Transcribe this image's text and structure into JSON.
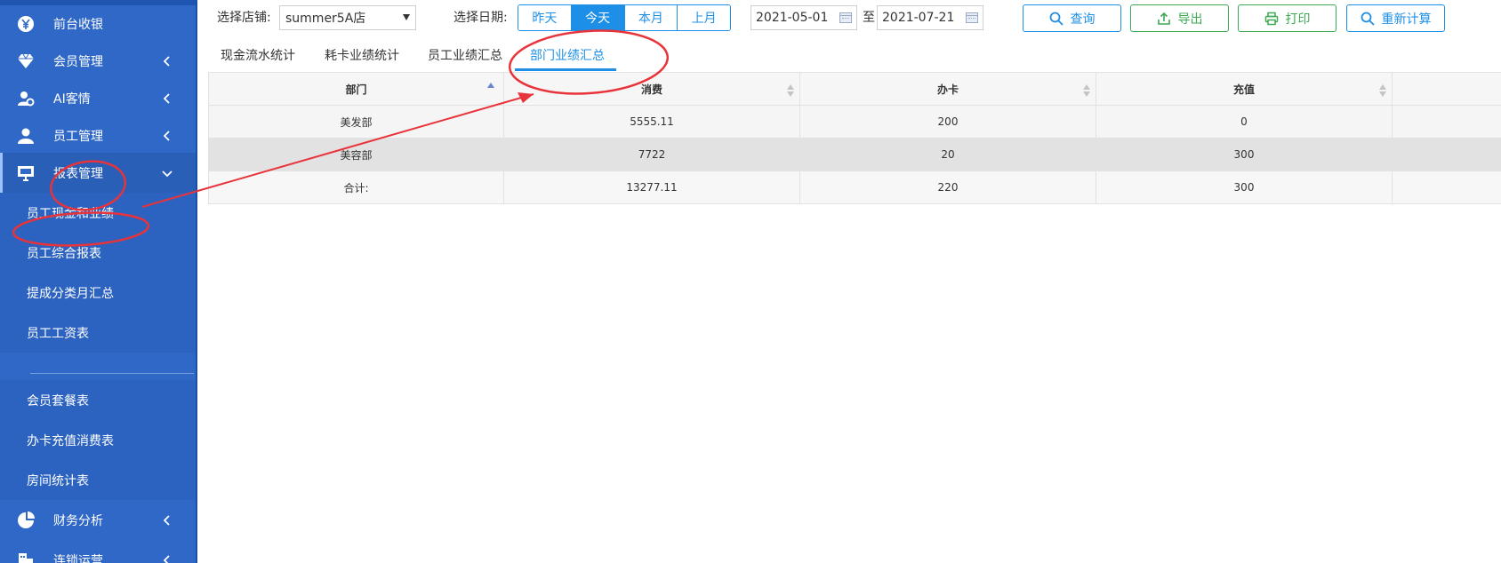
{
  "sidebar": {
    "items": [
      {
        "label": "前台收银",
        "icon": "yen-coin-icon"
      },
      {
        "label": "会员管理",
        "icon": "diamond-icon"
      },
      {
        "label": "AI客情",
        "icon": "user-gear-icon"
      },
      {
        "label": "员工管理",
        "icon": "person-icon"
      },
      {
        "label": "报表管理",
        "icon": "monitor-icon"
      },
      {
        "label": "财务分析",
        "icon": "pie-chart-icon"
      },
      {
        "label": "连锁运营",
        "icon": "building-icon"
      }
    ],
    "subitems": [
      "员工现金和业绩",
      "员工综合报表",
      "提成分类月汇总",
      "员工工资表",
      "会员套餐表",
      "办卡充值消费表",
      "房间统计表"
    ]
  },
  "filters": {
    "store_label": "选择店铺:",
    "store_value": "summer5A店",
    "date_label": "选择日期:",
    "quick_dates": [
      "昨天",
      "今天",
      "本月",
      "上月"
    ],
    "selected_quick": "今天",
    "date_from": "2021-05-01",
    "date_sep": "至",
    "date_to": "2021-07-21"
  },
  "buttons": {
    "query": "查询",
    "export": "导出",
    "print": "打印",
    "recalc": "重新计算"
  },
  "tabs": [
    "现金流水统计",
    "耗卡业绩统计",
    "员工业绩汇总",
    "部门业绩汇总"
  ],
  "active_tab": "部门业绩汇总",
  "table": {
    "headers": [
      "部门",
      "消费",
      "办卡",
      "充值"
    ],
    "rows": [
      [
        "美发部",
        "5555.11",
        "200",
        "0"
      ],
      [
        "美容部",
        "7722",
        "20",
        "300"
      ],
      [
        "合计:",
        "13277.11",
        "220",
        "300"
      ]
    ]
  },
  "colors": {
    "sidebar": "#2f68c6",
    "accent": "#1e8fe6",
    "green": "#3daa55",
    "annotation": "#e8333a"
  }
}
